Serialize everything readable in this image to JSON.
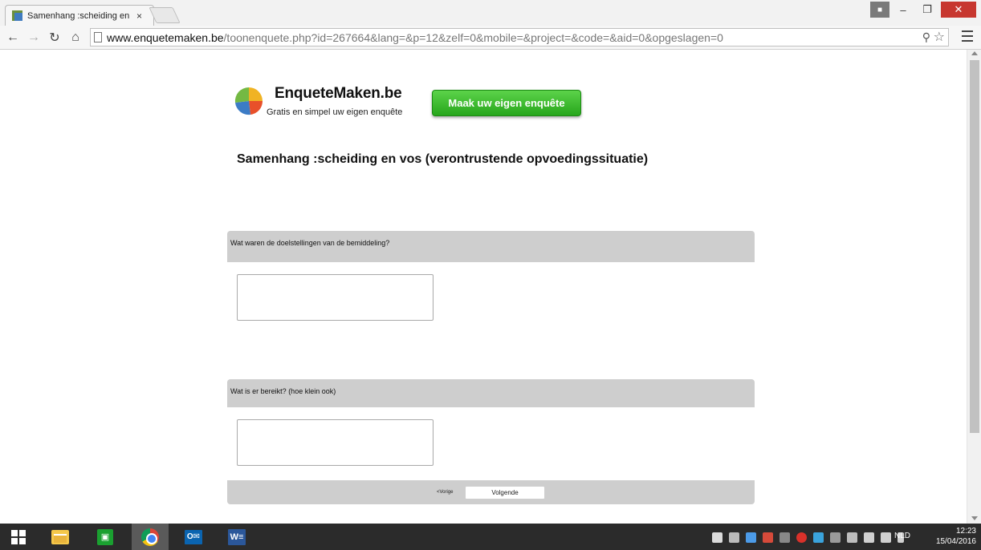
{
  "browser": {
    "tab_title": "Samenhang :scheiding en",
    "tab_close": "×",
    "url_host": "www.enquetemaken.be",
    "url_path": "/toonenquete.php?id=267664&lang=&p=12&zelf=0&mobile=&project=&code=&aid=0&opgeslagen=0"
  },
  "brand": {
    "name": "EnqueteMaken.be",
    "tagline": "Gratis en simpel uw eigen enquête",
    "cta_label": "Maak uw eigen enquête"
  },
  "survey": {
    "title": "Samenhang :scheiding en vos (verontrustende opvoedingssituatie)",
    "questions": [
      {
        "label": "Wat waren de doelstellingen van de bemiddeling?",
        "answer": ""
      },
      {
        "label": "Wat is er bereikt? (hoe klein ook)",
        "answer": ""
      }
    ],
    "prev_label": "<Vorige",
    "next_label": "Volgende"
  },
  "taskbar": {
    "language": "NLD",
    "time": "12:23",
    "date": "15/04/2016"
  }
}
